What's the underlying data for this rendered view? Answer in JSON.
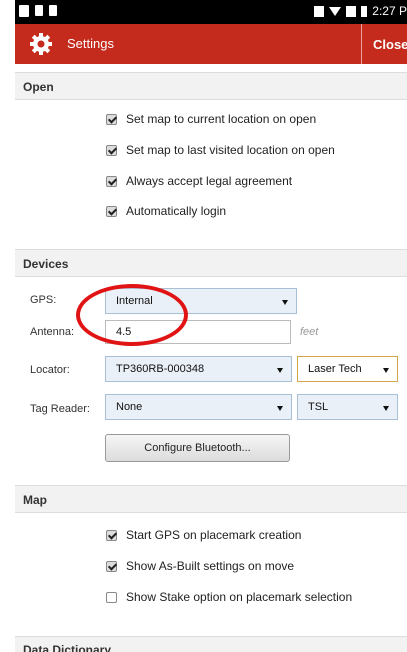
{
  "status_bar": {
    "time": "2:27 P"
  },
  "titlebar": {
    "title": "Settings",
    "close_label": "Close"
  },
  "sections": {
    "open": {
      "header": "Open",
      "options": [
        {
          "label": "Set map to current location on open",
          "checked": true
        },
        {
          "label": "Set map to last visited location on open",
          "checked": true
        },
        {
          "label": "Always accept legal agreement",
          "checked": true
        },
        {
          "label": "Automatically login",
          "checked": true
        }
      ]
    },
    "devices": {
      "header": "Devices",
      "gps": {
        "label": "GPS:",
        "value": "Internal"
      },
      "antenna": {
        "label": "Antenna:",
        "value": "4.5",
        "unit": "feet"
      },
      "locator": {
        "label": "Locator:",
        "value": "TP360RB-000348",
        "brand": "Laser Tech"
      },
      "tag_reader": {
        "label": "Tag Reader:",
        "value": "None",
        "brand": "TSL"
      },
      "bluetooth_button": "Configure Bluetooth..."
    },
    "map": {
      "header": "Map",
      "options": [
        {
          "label": "Start GPS on placemark creation",
          "checked": true
        },
        {
          "label": "Show As-Built settings on move",
          "checked": true
        },
        {
          "label": "Show Stake option on placemark selection",
          "checked": false
        }
      ]
    },
    "data_dictionary": {
      "header": "Data Dictionary"
    }
  },
  "colors": {
    "title_bar": "#c42b1c",
    "highlight": "#e01414"
  }
}
